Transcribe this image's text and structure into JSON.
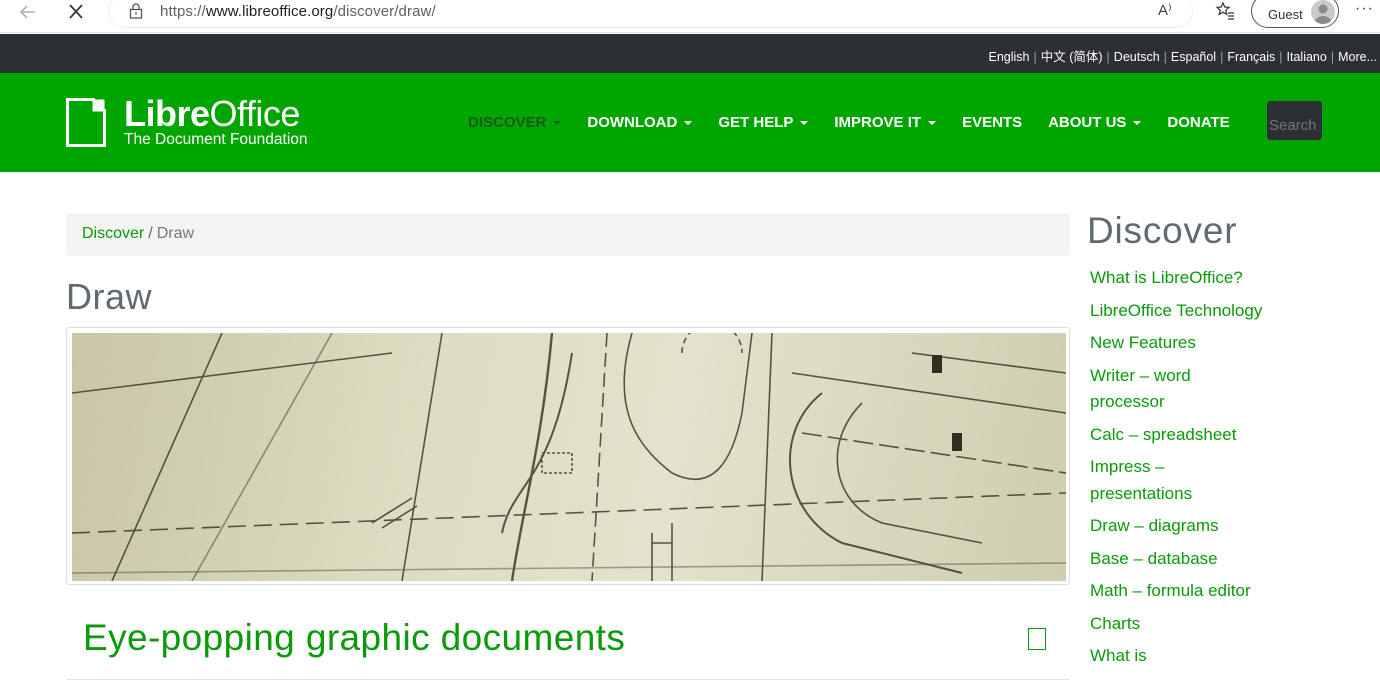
{
  "browser": {
    "url_prefix": "https://",
    "url_domain": "www.libreoffice.org",
    "url_path": "/discover/draw/",
    "read_aloud": "A⁾",
    "profile_label": "Guest",
    "more": "···"
  },
  "languages": [
    "English",
    "中文 (简体)",
    "Deutsch",
    "Español",
    "Français",
    "Italiano",
    "More..."
  ],
  "logo": {
    "name_bold": "Libre",
    "name_regular": "Office",
    "subtitle": "The Document Foundation"
  },
  "menu": [
    {
      "label": "DISCOVER",
      "caret": true,
      "active": true
    },
    {
      "label": "DOWNLOAD",
      "caret": true
    },
    {
      "label": "GET HELP",
      "caret": true
    },
    {
      "label": "IMPROVE IT",
      "caret": true
    },
    {
      "label": "EVENTS",
      "caret": false
    },
    {
      "label": "ABOUT US",
      "caret": true
    },
    {
      "label": "DONATE",
      "caret": false
    }
  ],
  "search": {
    "placeholder": "Search"
  },
  "breadcrumb": {
    "parent": "Discover",
    "separator": "/",
    "current": "Draw"
  },
  "page": {
    "title": "Draw",
    "section_heading": "Eye-popping graphic documents"
  },
  "sidebar": {
    "title": "Discover",
    "items": [
      "What is LibreOffice?",
      "LibreOffice Technology",
      "New Features",
      "Writer – word processor",
      "Calc – spreadsheet",
      "Impress – presentations",
      "Draw – diagrams",
      "Base – database",
      "Math – formula editor",
      "Charts",
      "What is"
    ]
  },
  "colors": {
    "brand_green": "#00a500",
    "link_green": "#0a9a0a",
    "dark_bar": "#2c2f33",
    "active_menu": "#1b5a1b"
  }
}
